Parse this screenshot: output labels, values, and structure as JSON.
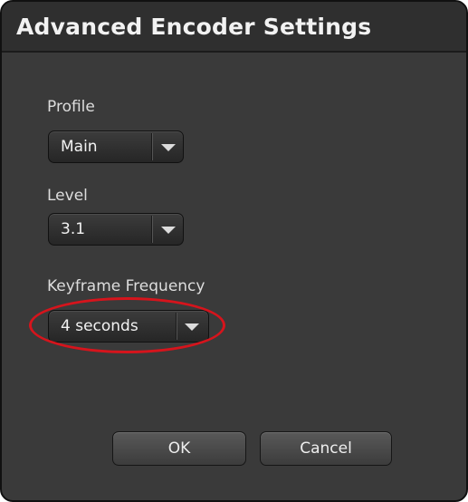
{
  "dialog": {
    "title": "Advanced Encoder Settings"
  },
  "profile": {
    "label": "Profile",
    "value": "Main"
  },
  "level": {
    "label": "Level",
    "value": "3.1"
  },
  "keyframe": {
    "label": "Keyframe Frequency",
    "value": "4 seconds"
  },
  "buttons": {
    "ok": "OK",
    "cancel": "Cancel"
  },
  "icons": {
    "dropdown": "chevron-down-icon"
  },
  "colors": {
    "dialog_background": "#3a3a3a",
    "highlight_ring": "#d6141c"
  }
}
